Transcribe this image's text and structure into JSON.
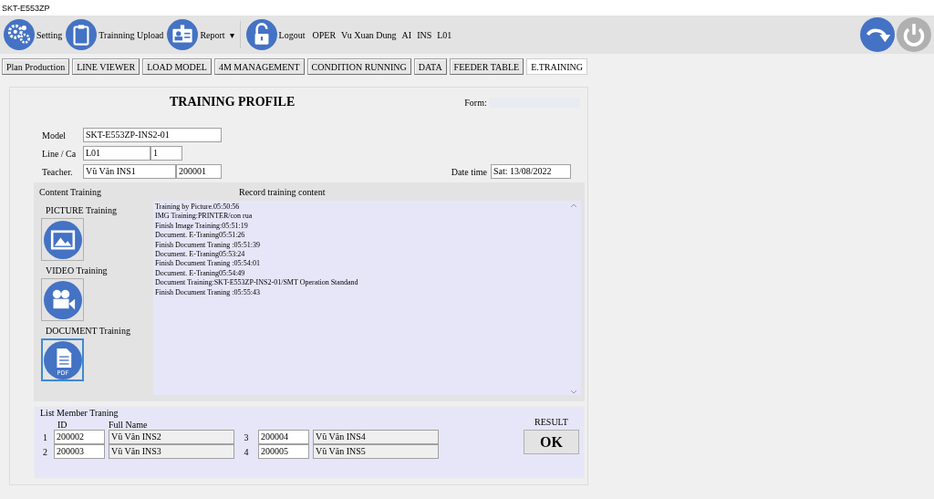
{
  "window": {
    "title": "SKT-E553ZP"
  },
  "toolbar": {
    "items": [
      {
        "kind": "gears",
        "label": "Setting"
      },
      {
        "kind": "clipboard",
        "label": "Trainning Upload"
      },
      {
        "kind": "idcard",
        "label": "Report",
        "dropdown": "▾"
      },
      {
        "kind": "lock",
        "label": "Logout"
      }
    ],
    "user_info": [
      "OPER",
      "Vu Xuan Dung",
      "AI",
      "INS",
      "L01"
    ],
    "right_buttons": [
      {
        "kind": "redo",
        "disabled": false
      },
      {
        "kind": "power",
        "disabled": true
      }
    ]
  },
  "tabs": [
    {
      "label": "Plan Production",
      "selected": false
    },
    {
      "label": "LINE VIEWER",
      "selected": false
    },
    {
      "label": "LOAD MODEL",
      "selected": false
    },
    {
      "label": "4M MANAGEMENT",
      "selected": false
    },
    {
      "label": "CONDITION RUNNING",
      "selected": false
    },
    {
      "label": "DATA",
      "selected": false
    },
    {
      "label": "FEEDER TABLE",
      "selected": false
    },
    {
      "label": "E.TRAINING",
      "selected": true
    }
  ],
  "profile": {
    "title": "TRAINING PROFILE",
    "form_label": "Form:",
    "model_label": "Model",
    "model": "SKT-E553ZP-INS2-01",
    "line_label": "Line / Ca",
    "line": "L01",
    "shift": "1",
    "teacher_label": "Teacher.",
    "teacher_name": "Vũ Văn INS1",
    "teacher_id": "200001",
    "date_label": "Date time",
    "date": "Sat: 13/08/2022"
  },
  "content": {
    "heading": "Content Training",
    "record_heading": "Record training content",
    "trainings": [
      {
        "kind": "picture",
        "label": "PICTURE Training",
        "selected": false
      },
      {
        "kind": "video",
        "label": "VIDEO Training",
        "selected": false
      },
      {
        "kind": "document",
        "label": "DOCUMENT Training",
        "selected": true,
        "badge": "PDF"
      }
    ],
    "records": [
      "Training by Picture.05:50:56",
      "IMG Training:PRINTER/con rua",
      "Finish Image Training:05:51:19",
      "Document. E-Traning05:51:26",
      "Finish Document Traning :05:51:39",
      "Document. E-Traning05:53:24",
      "Finish Document Traning :05:54:01",
      "Document. E-Traning05:54:49",
      "Document Training:SKT-E553ZP-INS2-01/SMT Operation Standand",
      "Finish Document Traning :05:55:43"
    ]
  },
  "members": {
    "heading": "List Member Traning",
    "id_header": "ID",
    "name_header": "Full Name",
    "rows": [
      {
        "no": "1",
        "id": "200002",
        "name": "Vũ Văn INS2"
      },
      {
        "no": "2",
        "id": "200003",
        "name": "Vũ Văn INS3"
      },
      {
        "no": "3",
        "id": "200004",
        "name": "Vũ Văn INS4"
      },
      {
        "no": "4",
        "id": "200005",
        "name": "Vũ Văn INS5"
      }
    ],
    "result_label": "RESULT",
    "result": "OK"
  }
}
